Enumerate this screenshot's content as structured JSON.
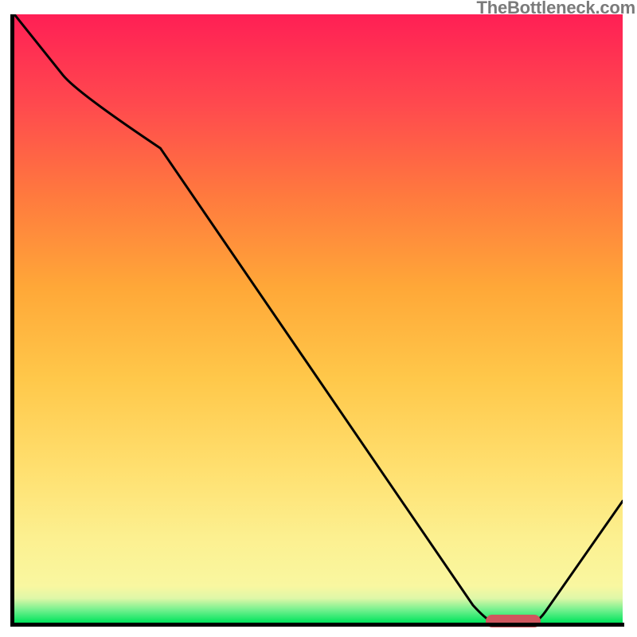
{
  "watermark": "TheBottleneck.com",
  "colors": {
    "frame": "#000000",
    "marker": "#d0565e",
    "curve": "#000000",
    "gradient_top": "#ff1f55",
    "gradient_bottom": "#00e45c"
  },
  "chart_data": {
    "type": "line",
    "title": "",
    "xlabel": "",
    "ylabel": "",
    "xlim": [
      0,
      100
    ],
    "ylim": [
      0,
      100
    ],
    "x": [
      0,
      8,
      24,
      78,
      86,
      100
    ],
    "values": [
      100,
      90,
      78,
      0,
      0,
      20
    ],
    "marker": {
      "x_start": 78,
      "x_end": 86,
      "y": 0
    },
    "gradient_stops": [
      {
        "pos": 0,
        "color": "#00e45c"
      },
      {
        "pos": 2,
        "color": "#6ef08c"
      },
      {
        "pos": 4,
        "color": "#dff7a8"
      },
      {
        "pos": 6,
        "color": "#f9f7a0"
      },
      {
        "pos": 14,
        "color": "#fcf090"
      },
      {
        "pos": 25,
        "color": "#ffe070"
      },
      {
        "pos": 40,
        "color": "#ffc84a"
      },
      {
        "pos": 55,
        "color": "#ffa838"
      },
      {
        "pos": 70,
        "color": "#ff7a3e"
      },
      {
        "pos": 85,
        "color": "#ff4a4e"
      },
      {
        "pos": 100,
        "color": "#ff1f55"
      }
    ]
  }
}
